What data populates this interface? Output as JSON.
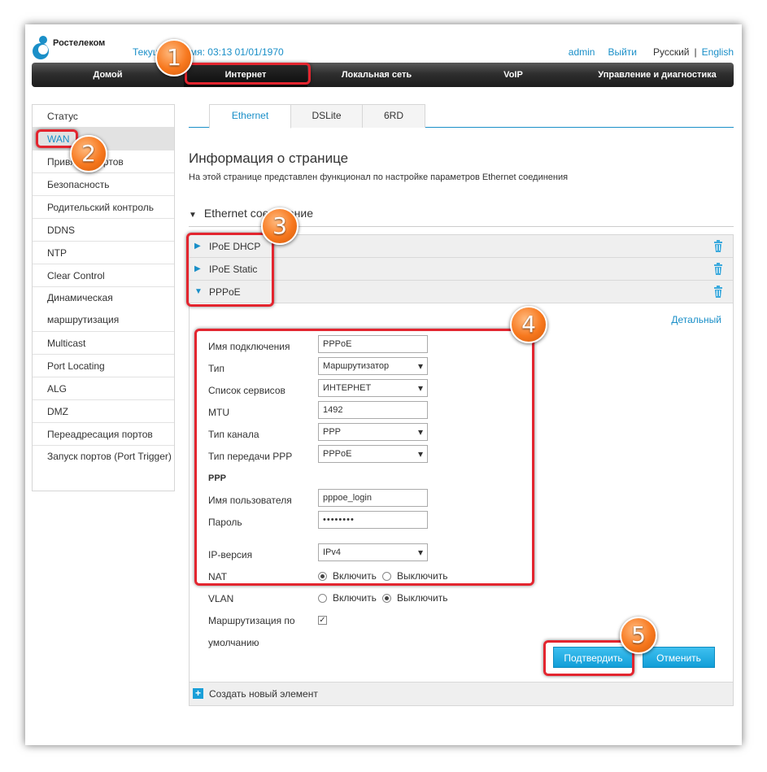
{
  "header": {
    "logo_text": "Ростелеком",
    "time_text": "Текущее время: 03:13 01/01/1970",
    "user": "admin",
    "logout": "Выйти",
    "lang_ru": "Русский",
    "lang_sep": "|",
    "lang_en": "English"
  },
  "nav": {
    "items": [
      "Домой",
      "Интернет",
      "Локальная сеть",
      "VoIP",
      "Управление и диагностика"
    ],
    "active": "Интернет"
  },
  "sidebar": {
    "items": [
      "Статус",
      "WAN",
      "Привязка портов",
      "Безопасность",
      "Родительский контроль",
      "DDNS",
      "NTP",
      "Clear Control",
      "Динамическая маршрутизация",
      "Multicast",
      "Port Locating",
      "ALG",
      "DMZ",
      "Переадресация портов",
      "Запуск портов (Port Trigger)"
    ],
    "active": "WAN"
  },
  "tabs": [
    "Ethernet",
    "DSLite",
    "6RD"
  ],
  "page": {
    "title": "Информация о странице",
    "description": "На этой странице представлен функционал по настройке параметров Ethernet соединения",
    "section_title": "Ethernet соединение"
  },
  "connections": [
    "IPoE DHCP",
    "IPoE Static",
    "PPPoE"
  ],
  "form": {
    "detail_link": "Детальный",
    "conn_name_label": "Имя подключения",
    "conn_name_value": "PPPoE",
    "type_label": "Тип",
    "type_value": "Маршрутизатор",
    "services_label": "Список сервисов",
    "services_value": "ИНТЕРНЕТ",
    "mtu_label": "MTU",
    "mtu_value": "1492",
    "channel_label": "Тип канала",
    "channel_value": "PPP",
    "ppp_transfer_label": "Тип передачи PPP",
    "ppp_transfer_value": "PPPoE",
    "ppp_heading": "PPP",
    "username_label": "Имя пользователя",
    "username_value": "pppoe_login",
    "password_label": "Пароль",
    "password_value": "••••••••",
    "ip_version_label": "IP-версия",
    "ip_version_value": "IPv4",
    "nat_label": "NAT",
    "vlan_label": "VLAN",
    "enable": "Включить",
    "disable": "Выключить",
    "nat_state": "Включить",
    "vlan_state": "Выключить",
    "default_route_label_1": "Маршрутизация по",
    "default_route_label_2": "умолчанию",
    "default_route_checked": true,
    "confirm_button": "Подтвердить",
    "cancel_button": "Отменить",
    "create_new": "Создать новый элемент"
  },
  "badges": [
    "1",
    "2",
    "3",
    "4",
    "5"
  ],
  "colors": {
    "accent": "#1a8fc8",
    "highlight": "#e3252f",
    "badge": "#f7781e"
  }
}
